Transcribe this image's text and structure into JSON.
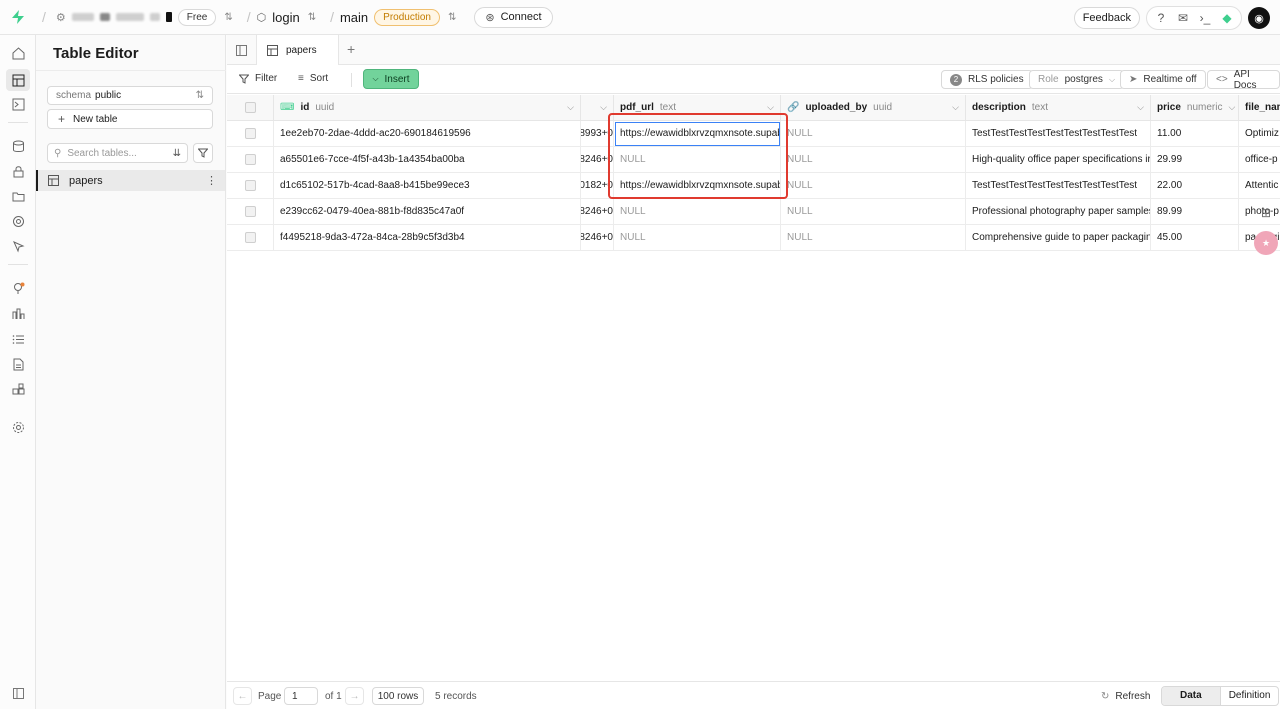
{
  "topbar": {
    "plan_badge": "Free",
    "project": "login",
    "branch": "main",
    "env_badge": "Production",
    "connect_label": "Connect",
    "feedback_label": "Feedback",
    "avatar_glyph": "◉"
  },
  "sidebar": {
    "title": "Table Editor",
    "schema_label": "schema",
    "schema_value": "public",
    "new_table_label": "New table",
    "search_placeholder": "Search tables...",
    "tables": [
      {
        "name": "papers"
      }
    ]
  },
  "tabs": [
    {
      "label": "papers"
    }
  ],
  "toolbar": {
    "filter_label": "Filter",
    "sort_label": "Sort",
    "insert_label": "Insert",
    "rls_count": "2",
    "rls_label": "RLS policies",
    "role_prefix": "Role",
    "role_value": "postgres",
    "realtime_label": "Realtime off",
    "api_docs_label": "API Docs"
  },
  "grid": {
    "columns": {
      "id": {
        "name": "id",
        "type": "uuid"
      },
      "pdf_url": {
        "name": "pdf_url",
        "type": "text"
      },
      "uploaded_by": {
        "name": "uploaded_by",
        "type": "uuid"
      },
      "description": {
        "name": "description",
        "type": "text"
      },
      "price": {
        "name": "price",
        "type": "numeric"
      },
      "file_name": {
        "name": "file_nam"
      }
    },
    "rows": [
      {
        "id": "1ee2eb70-2dae-4ddd-ac20-690184619596",
        "partial": "8993+0",
        "pdf_url": "https://ewawidblxrvzqmxnsote.supab",
        "uploaded_by": "NULL",
        "description": "TestTestTestTestTestTestTestTestTest",
        "price": "11.00",
        "file_name": "Optimiz"
      },
      {
        "id": "a65501e6-7cce-4f5f-a43b-1a4354ba00ba",
        "partial": "8246+0",
        "pdf_url": "NULL",
        "uploaded_by": "NULL",
        "description": "High-quality office paper specifications ir",
        "price": "29.99",
        "file_name": "office-p"
      },
      {
        "id": "d1c65102-517b-4cad-8aa8-b415be99ece3",
        "partial": "0182+0",
        "pdf_url": "https://ewawidblxrvzqmxnsote.supab",
        "uploaded_by": "NULL",
        "description": "TestTestTestTestTestTestTestTestTest",
        "price": "22.00",
        "file_name": "Attentic"
      },
      {
        "id": "e239cc62-0479-40ea-881b-f8d835c47a0f",
        "partial": "8246+0",
        "pdf_url": "NULL",
        "uploaded_by": "NULL",
        "description": "Professional photography paper samples",
        "price": "89.99",
        "file_name": "photo-p"
      },
      {
        "id": "f4495218-9da3-472a-84ca-28b9c5f3d3b4",
        "partial": "8246+0",
        "pdf_url": "NULL",
        "uploaded_by": "NULL",
        "description": "Comprehensive guide to paper packaging",
        "price": "45.00",
        "file_name": "packagi"
      }
    ]
  },
  "footer": {
    "page_label": "Page",
    "page_value": "1",
    "of_label": "of 1",
    "rows_label": "100 rows",
    "records_label": "5 records",
    "refresh_label": "Refresh",
    "data_label": "Data",
    "definition_label": "Definition"
  },
  "colors": {
    "accent_green": "#72d39b",
    "highlight_red": "#e03a2f",
    "production_orange": "#c27c00"
  }
}
